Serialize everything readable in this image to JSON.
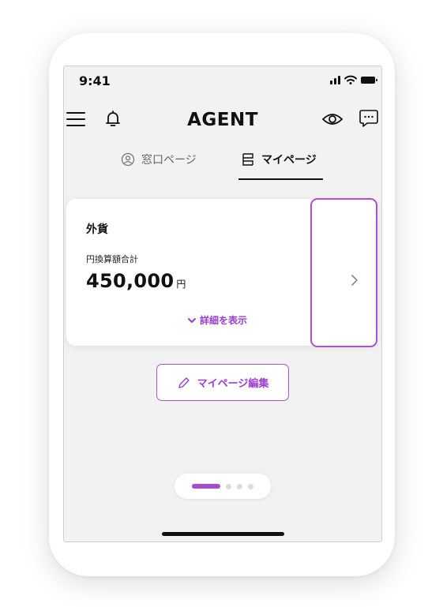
{
  "status_bar": {
    "time": "9:41"
  },
  "header": {
    "app_title": "AGENT"
  },
  "tabs": [
    {
      "label": "窓口ページ",
      "active": false
    },
    {
      "label": "マイページ",
      "active": true
    }
  ],
  "card": {
    "title": "外貨",
    "subtitle": "円換算額合計",
    "amount": "450,000",
    "currency_unit": "円",
    "details_label": "詳細を表示"
  },
  "edit_button": {
    "label": "マイページ編集"
  },
  "pager": {
    "total_pages": 4,
    "current_page": 1
  },
  "colors": {
    "accent": "#a94bd2",
    "highlight": "#b04fd4",
    "background": "#f2f2f2",
    "text": "#111111"
  }
}
